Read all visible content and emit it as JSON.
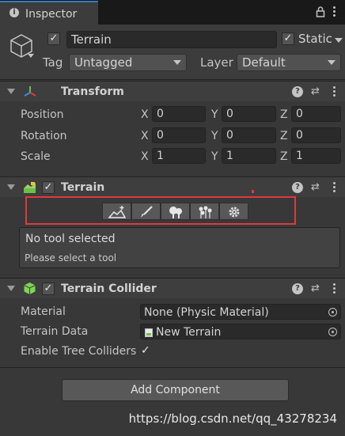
{
  "tab": {
    "title": "Inspector",
    "info_icon": "info-icon",
    "lock_icon": "lock-icon",
    "menu_icon": "kebab-menu-icon"
  },
  "header": {
    "active": true,
    "name": "Terrain",
    "static_checked": true,
    "static_label": "Static",
    "tag_label": "Tag",
    "tag_value": "Untagged",
    "layer_label": "Layer",
    "layer_value": "Default"
  },
  "transform": {
    "title": "Transform",
    "rows": [
      {
        "label": "Position",
        "x": "0",
        "y": "0",
        "z": "0"
      },
      {
        "label": "Rotation",
        "x": "0",
        "y": "0",
        "z": "0"
      },
      {
        "label": "Scale",
        "x": "1",
        "y": "1",
        "z": "1"
      }
    ],
    "axes": {
      "x": "X",
      "y": "Y",
      "z": "Z"
    }
  },
  "terrain": {
    "title": "Terrain",
    "enabled": true,
    "tools": [
      "raise-lower-terrain-icon",
      "paint-brush-icon",
      "paint-trees-icon",
      "paint-details-icon",
      "terrain-settings-icon"
    ],
    "info_title": "No tool selected",
    "info_subtitle": "Please select a tool"
  },
  "collider": {
    "title": "Terrain Collider",
    "enabled": true,
    "material_label": "Material",
    "material_value": "None (Physic Material)",
    "data_label": "Terrain Data",
    "data_value": "New Terrain",
    "trees_label": "Enable Tree Colliders",
    "trees_checked": true
  },
  "add_component_label": "Add Component",
  "watermark": "https://blog.csdn.net/qq_43278234",
  "colors": {
    "background": "#383838",
    "header": "#3e3e3e",
    "field": "#2a2a2a",
    "highlight": "#e0393d",
    "accent": "#3a79bb"
  }
}
